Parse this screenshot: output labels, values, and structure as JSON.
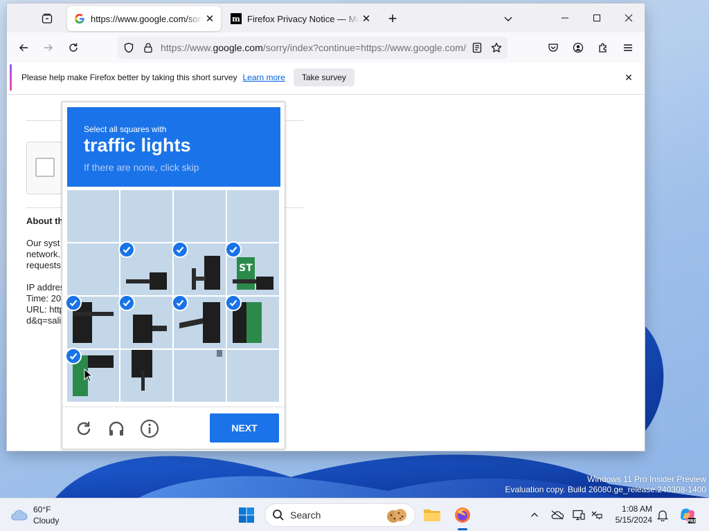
{
  "desktop": {
    "watermark_line1": "Windows 11 Pro Insider Preview",
    "watermark_line2": "Evaluation copy. Build 26080.ge_release.240308-1400"
  },
  "browser": {
    "tabs": [
      {
        "title": "https://www.google.com/sorry/index?continue",
        "favicon": "google-g-icon",
        "active": true
      },
      {
        "title": "Firefox Privacy Notice — Mozilla",
        "favicon": "mozilla-m-icon",
        "active": false
      }
    ],
    "url_prefix": "https://www.",
    "url_domain": "google.com",
    "url_rest": "/sorry/index?continue=https://www.google.com/search",
    "notification": {
      "message": "Please help make Firefox better by taking this short survey",
      "learn_more": "Learn more",
      "button": "Take survey"
    }
  },
  "page": {
    "about_heading": "About th",
    "para_lines": [
      "Our syst",
      "network.",
      "requests"
    ],
    "info_lines": [
      "IP addres",
      "Time: 20",
      "URL: http",
      "d&q=sali"
    ]
  },
  "captcha": {
    "instruction": "Select all squares with",
    "target": "traffic lights",
    "hint": "If there are none, click skip",
    "next_label": "NEXT",
    "selected_tiles": [
      5,
      6,
      7,
      8,
      9,
      10,
      11,
      12
    ],
    "accent": "#1a73e8"
  },
  "taskbar": {
    "weather_temp": "60°F",
    "weather_desc": "Cloudy",
    "search_label": "Search",
    "time": "1:08 AM",
    "date": "5/15/2024"
  }
}
